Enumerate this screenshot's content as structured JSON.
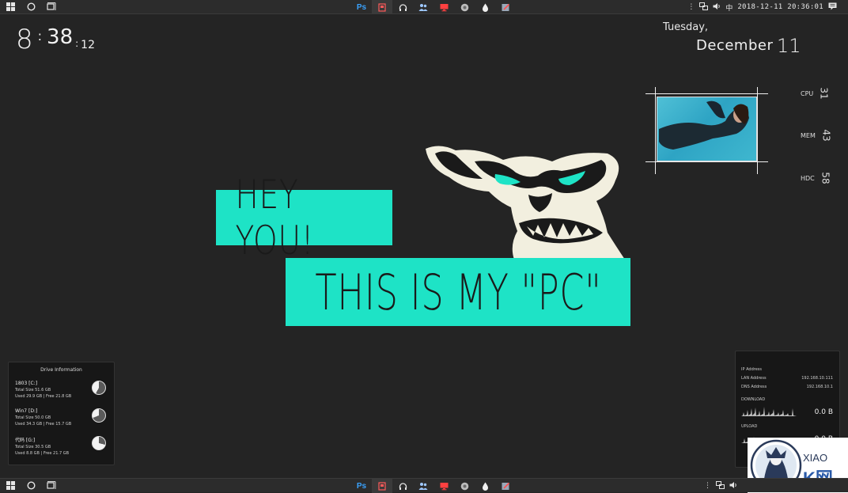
{
  "taskbar": {
    "apps": [
      {
        "name": "photoshop",
        "label": "Ps"
      },
      {
        "name": "app-red",
        "label": ""
      },
      {
        "name": "headphones",
        "label": ""
      },
      {
        "name": "people",
        "label": ""
      },
      {
        "name": "monitor",
        "label": ""
      },
      {
        "name": "chrome",
        "label": ""
      },
      {
        "name": "drop",
        "label": ""
      },
      {
        "name": "paint",
        "label": ""
      }
    ],
    "ime": "中",
    "clock": "2018-12-11 20:36:01"
  },
  "clock_widget": {
    "hour": "8",
    "minute": "38",
    "second": "12"
  },
  "date_widget": {
    "day": "Tuesday,",
    "month": "December",
    "date": "11"
  },
  "stats": [
    {
      "label": "CPU",
      "value": "31"
    },
    {
      "label": "MEM",
      "value": "43"
    },
    {
      "label": "HDC",
      "value": "58"
    }
  ],
  "banner": {
    "line1": "HEY YOU!",
    "line2": "THIS IS MY \"PC\""
  },
  "drives": {
    "title": "Drive Information",
    "items": [
      {
        "name": "1803 [C:]",
        "total": "Total Size  51.6 GB",
        "usage": "Used 29.9 GB   |   Free 21.8 GB",
        "used_fraction": 0.58
      },
      {
        "name": "Win7 [D:]",
        "total": "Total Size  50.0 GB",
        "usage": "Used 34.3 GB   |   Free 15.7 GB",
        "used_fraction": 0.69
      },
      {
        "name": "代码 [G:]",
        "total": "Total Size  30.5 GB",
        "usage": "Used 8.8 GB   |   Free 21.7 GB",
        "used_fraction": 0.29
      }
    ]
  },
  "network": {
    "ip_label": "IP Address",
    "lan_label": "LAN Address",
    "lan_value": "192.168.10.111",
    "dns_label": "DNS Address",
    "dns_value": "192.168.10.1",
    "download_label": "DOWNLOAD",
    "download_value": "0.0 B",
    "upload_label": "UPLOAD",
    "upload_value": "0.0 B"
  },
  "watermark": {
    "text": "XIAO",
    "k": "K网"
  }
}
